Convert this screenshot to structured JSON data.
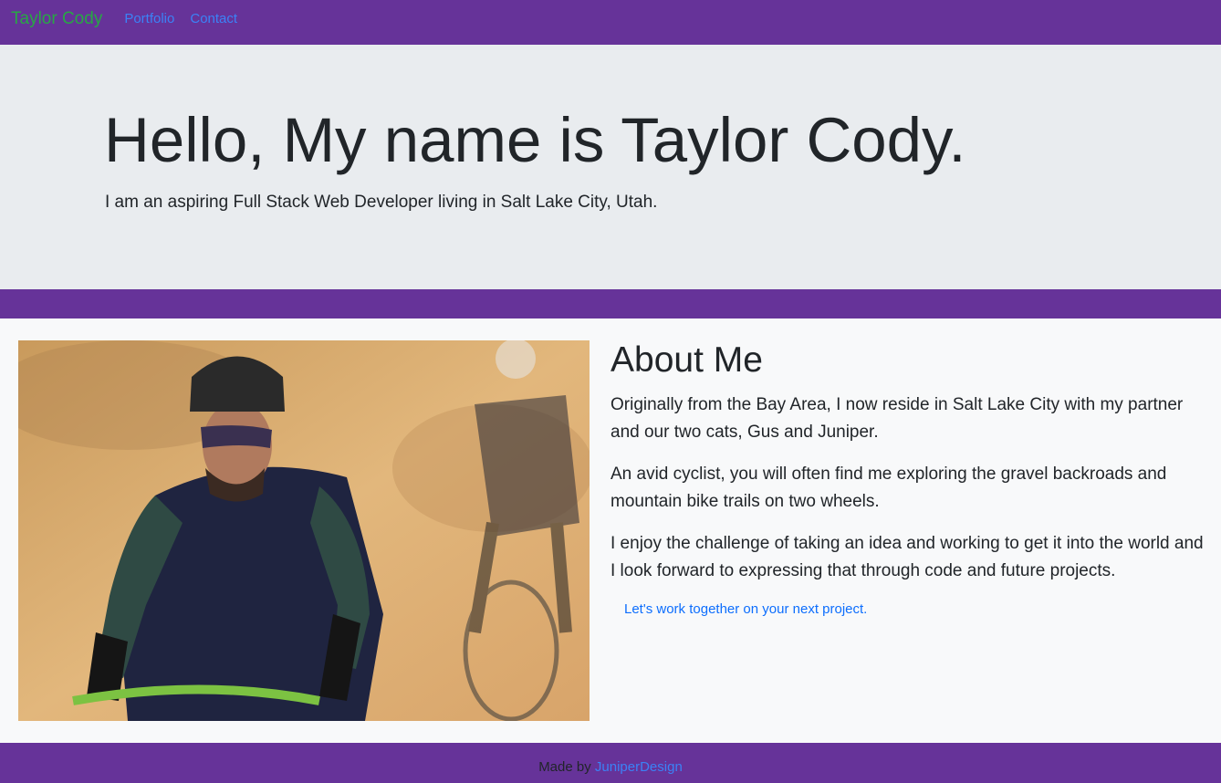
{
  "nav": {
    "brand": "Taylor Cody",
    "links": [
      "Portfolio",
      "Contact"
    ]
  },
  "hero": {
    "title": "Hello, My name is Taylor Cody.",
    "subtitle": "I am an aspiring Full Stack Web Developer living in Salt Lake City, Utah."
  },
  "about": {
    "title": "About Me",
    "paragraphs": [
      "Originally from the Bay Area, I now reside in Salt Lake City with my partner and our two cats, Gus and Juniper.",
      "An avid cyclist, you will often find me exploring the gravel backroads and mountain bike trails on two wheels.",
      "I enjoy the challenge of taking an idea and working to get it into the world and I look forward to expressing that through code and future projects."
    ],
    "cta": "Let's work together on your next project."
  },
  "footer": {
    "prefix": "Made by",
    "link": "JuniperDesign"
  },
  "colors": {
    "navbar": "#663399",
    "brand": "#28a745",
    "link": "#3b82f6",
    "jumbotron": "#e9ecef"
  }
}
